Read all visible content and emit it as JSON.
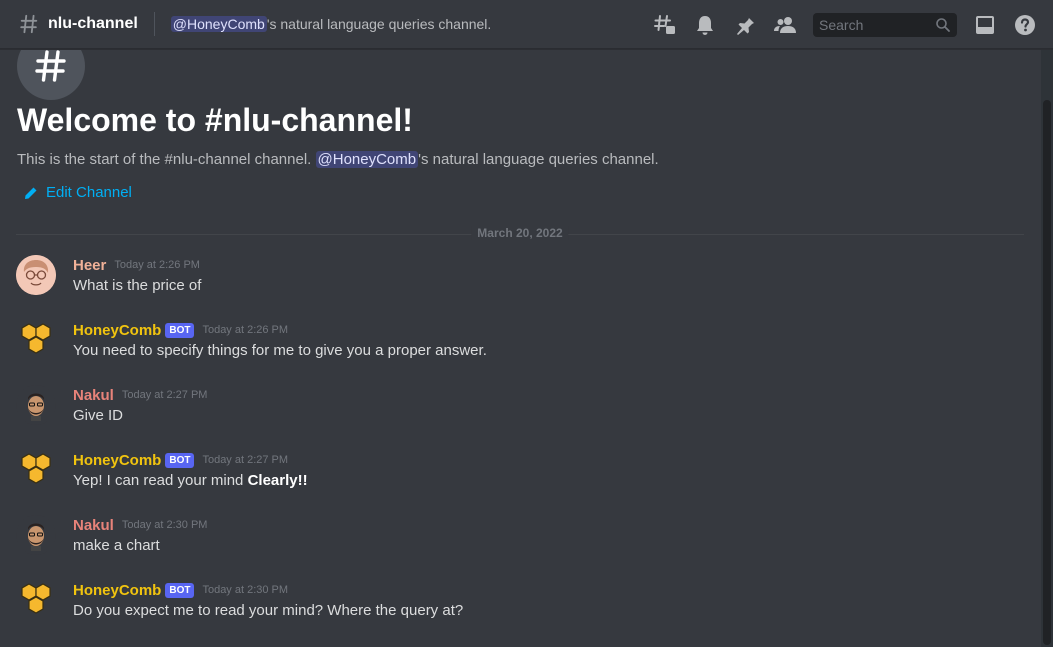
{
  "header": {
    "channel_name": "nlu-channel",
    "topic_mention": "@HoneyComb",
    "topic_rest": "'s natural language queries channel.",
    "search_placeholder": "Search",
    "icons": [
      "threads-icon",
      "bell-icon",
      "pin-icon",
      "members-icon",
      "search-icon",
      "inbox-icon",
      "help-icon"
    ]
  },
  "welcome": {
    "title": "Welcome to #nlu-channel!",
    "subtitle_prefix": "This is the start of the #nlu-channel channel. ",
    "subtitle_mention": "@HoneyComb",
    "subtitle_suffix": "'s natural language queries channel.",
    "edit_label": "Edit Channel"
  },
  "date_divider": "March 20, 2022",
  "messages": [
    {
      "author": "Heer",
      "bot": false,
      "bot_label": "",
      "time": "Today at 2:26 PM",
      "text": "What is the price of",
      "bold": ""
    },
    {
      "author": "HoneyComb",
      "bot": true,
      "bot_label": "BOT",
      "time": "Today at 2:26 PM",
      "text": "You need to specify things for me to give you a proper answer.",
      "bold": ""
    },
    {
      "author": "Nakul",
      "bot": false,
      "bot_label": "",
      "time": "Today at 2:27 PM",
      "text": "Give ID",
      "bold": ""
    },
    {
      "author": "HoneyComb",
      "bot": true,
      "bot_label": "BOT",
      "time": "Today at 2:27 PM",
      "text": "Yep! I can read your mind ",
      "bold": "Clearly!!"
    },
    {
      "author": "Nakul",
      "bot": false,
      "bot_label": "",
      "time": "Today at 2:30 PM",
      "text": "make a chart",
      "bold": ""
    },
    {
      "author": "HoneyComb",
      "bot": true,
      "bot_label": "BOT",
      "time": "Today at 2:30 PM",
      "text": "Do you expect me to read your mind? Where the query at?",
      "bold": ""
    }
  ],
  "colors": {
    "background": "#36393f",
    "heer": "#f0b198",
    "honeycomb": "#f1c40f",
    "nakul": "#e8837a",
    "link": "#00aff4",
    "bot_tag": "#5865f2"
  }
}
